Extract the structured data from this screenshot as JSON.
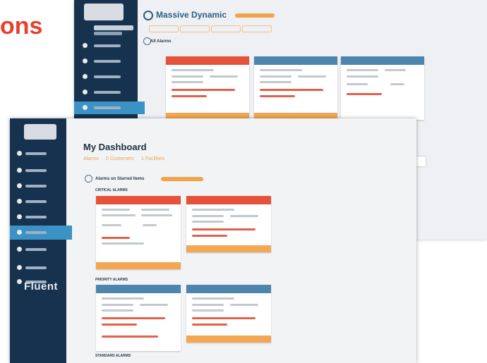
{
  "hero_text": "ons",
  "back_screen": {
    "org_title": "Massive Dynamic",
    "section_title": "All Alarms"
  },
  "front_screen": {
    "page_title": "My Dashboard",
    "tabs": [
      "Alarms",
      "0 Customers",
      "1 Facilities"
    ],
    "section_title": "Alarms on Starred Items",
    "groups": [
      "CRITICAL ALARMS",
      "PRIORITY ALARMS",
      "STANDARD ALARMS"
    ],
    "logo_text": "Fluent"
  },
  "colors": {
    "sidebar": "#17324f",
    "accent_orange": "#f0a34d",
    "critical_red": "#e6513a",
    "priority_blue": "#4d86ad",
    "active_nav": "#3a93c4"
  }
}
